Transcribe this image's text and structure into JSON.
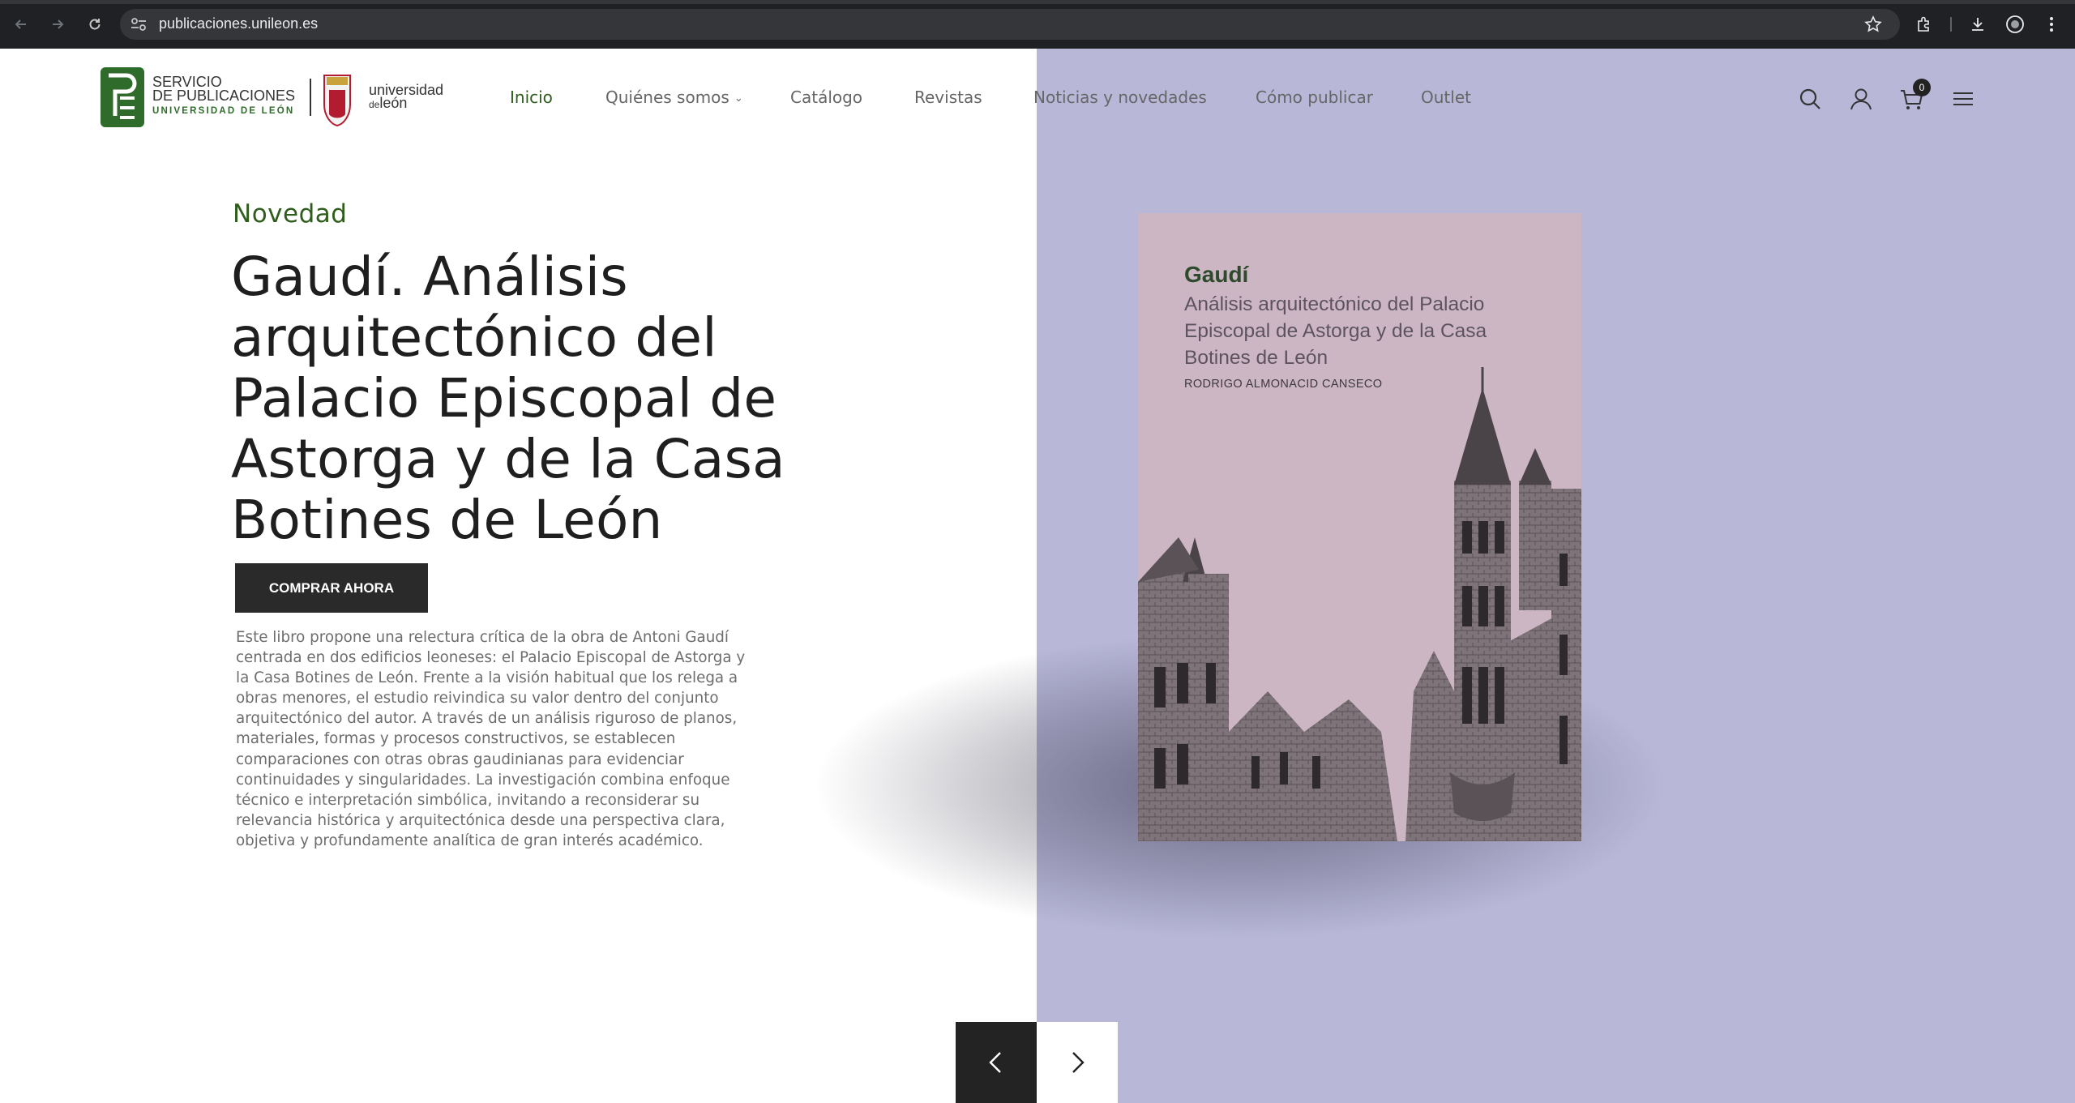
{
  "browser": {
    "url": "publicaciones.unileon.es"
  },
  "header": {
    "logo": {
      "line1": "SERVICIO",
      "line2": "DE PUBLICACIONES",
      "line3": "UNIVERSIDAD DE LEÓN",
      "university_name_1": "universidad",
      "university_name_de": "de",
      "university_name_2": "león"
    },
    "nav": [
      {
        "label": "Inicio",
        "active": true
      },
      {
        "label": "Quiénes somos",
        "has_dropdown": true
      },
      {
        "label": "Catálogo"
      },
      {
        "label": "Revistas"
      },
      {
        "label": "Noticias y novedades"
      },
      {
        "label": "Cómo publicar"
      },
      {
        "label": "Outlet"
      }
    ],
    "cart_count": "0",
    "icons": [
      "search-icon",
      "user-icon",
      "cart-icon",
      "menu-icon"
    ]
  },
  "hero": {
    "kicker": "Novedad",
    "title": "Gaudí. Análisis arquitectónico del Palacio Episcopal de Astorga y de la Casa Botines de León",
    "button_label": "COMPRAR AHORA",
    "description": "Este libro propone una relectura crítica de la obra de Antoni Gaudí centrada en dos edificios leoneses: el Palacio Episcopal de Astorga y la Casa Botines de León. Frente a la visión habitual que los relega a obras menores, el estudio reivindica su valor dentro del conjunto arquitectónico del autor. A través de un análisis riguroso de planos, materiales, formas y procesos constructivos, se establecen comparaciones con otras obras gaudinianas para evidenciar continuidades y singularidades. La investigación combina enfoque técnico e interpretación simbólica, invitando a reconsiderar su relevancia histórica y arquitectónica desde una perspectiva clara, objetiva y profundamente analítica de gran interés académico."
  },
  "book_cover": {
    "title": "Gaudí",
    "subtitle": "Análisis arquitectónico del Palacio Episcopal de Astorga y de la Casa Botines de León",
    "author": "RODRIGO ALMONACID CANSECO"
  },
  "colors": {
    "accent_green": "#2f5d1e",
    "panel_lavender": "#b8b7d8",
    "cover_pink": "#cdb6c3",
    "button_dark": "#2a2a2a"
  },
  "slider": {
    "prev_icon": "chevron-left-icon",
    "next_icon": "chevron-right-icon"
  }
}
